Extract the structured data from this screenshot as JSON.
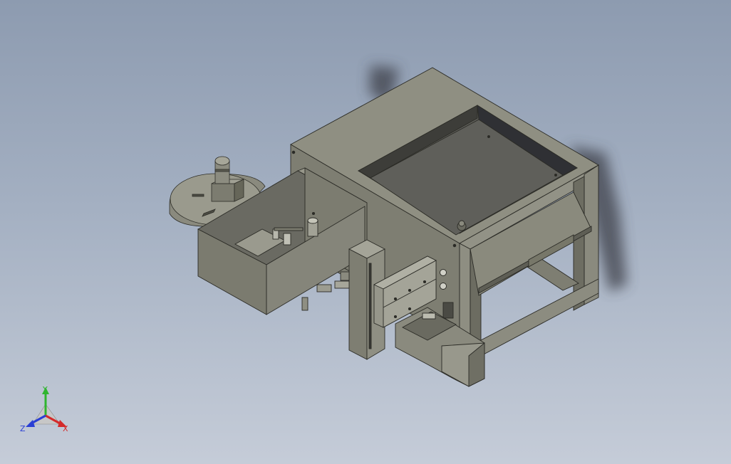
{
  "viewport": {
    "background_top": "#8d9bb0",
    "background_bottom": "#c5ccd8"
  },
  "model": {
    "body_color": "#87877a",
    "shadow_color": "#3e4048"
  },
  "triad": {
    "y_label": "Y",
    "x_label": "X",
    "z_label": "Z",
    "y_color": "#2fb52f",
    "x_color": "#d42a2a",
    "z_color": "#2a3fd4"
  }
}
